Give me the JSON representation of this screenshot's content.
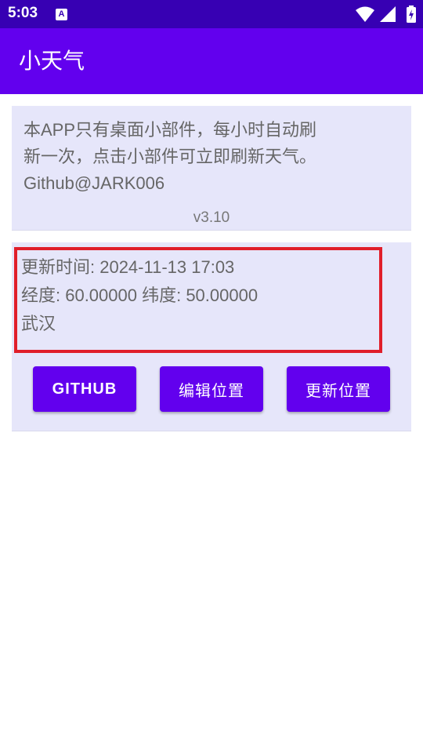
{
  "status_bar": {
    "time": "5:03",
    "notification_icon": "A",
    "icons": [
      "wifi-icon",
      "cellular-signal-icon",
      "battery-charging-icon"
    ]
  },
  "app_bar": {
    "title": "小天气"
  },
  "info_card": {
    "description": "本APP只有桌面小部件，每小时自动刷\n新一次，点击小部件可立即刷新天气。\nGithub@JARK006",
    "version": "v3.10"
  },
  "weather_card": {
    "update_time": "更新时间: 2024-11-13 17:03",
    "coordinates": "经度: 60.00000 纬度: 50.00000",
    "city": "武汉"
  },
  "buttons": {
    "github": "GITHUB",
    "edit_location": "编辑位置",
    "update_location": "更新位置"
  },
  "colors": {
    "status_bar": "#3700b3",
    "primary": "#6200ee",
    "card_background": "#e6e6fa",
    "highlight_border": "#e01e2a",
    "text_secondary": "#666666"
  }
}
